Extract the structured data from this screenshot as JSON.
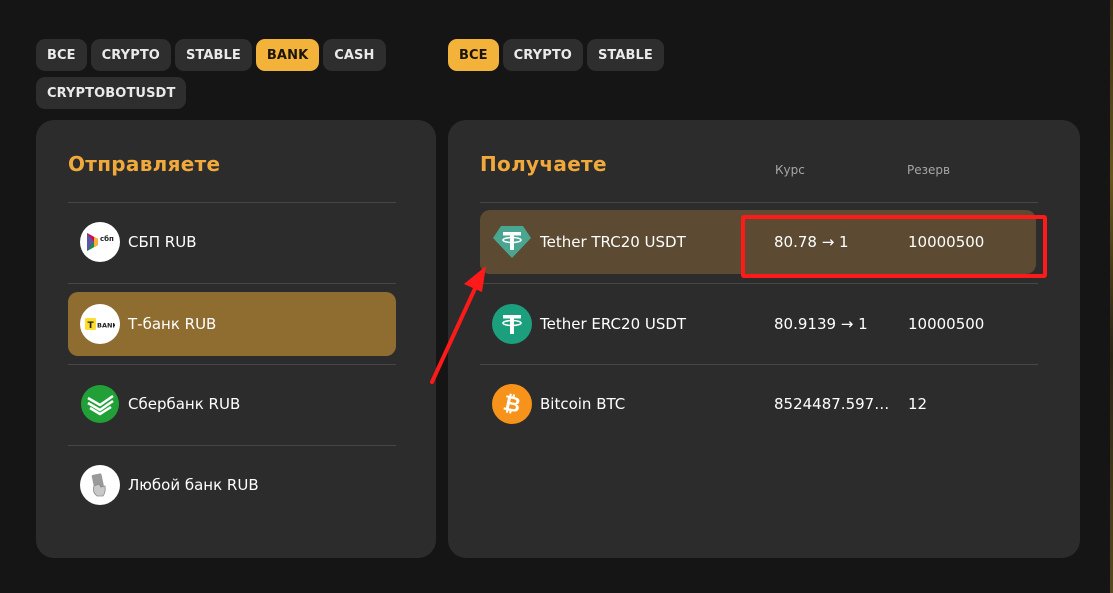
{
  "send_filters": [
    "ВСЕ",
    "CRYPTO",
    "STABLE",
    "BANK",
    "CASH",
    "CRYPTOBOTUSDT"
  ],
  "send_filter_active": "BANK",
  "receive_filters": [
    "ВСЕ",
    "CRYPTO",
    "STABLE"
  ],
  "receive_filter_active": "ВСЕ",
  "send": {
    "title": "Отправляете",
    "items": [
      {
        "label": "СБП RUB",
        "icon": "sbp-logo-icon"
      },
      {
        "label": "Т-банк RUB",
        "icon": "tbank-logo-icon"
      },
      {
        "label": "Сбербанк RUB",
        "icon": "sberbank-logo-icon"
      },
      {
        "label": "Любой банк RUB",
        "icon": "card-in-hand-icon"
      }
    ],
    "selected": "Т-банк RUB"
  },
  "receive": {
    "title": "Получаете",
    "rate_header": "Курс",
    "reserve_header": "Резерв",
    "items": [
      {
        "label": "Tether TRC20 USDT",
        "rate": "80.78 → 1",
        "reserve": "10000500",
        "icon": "tether-trc20-icon"
      },
      {
        "label": "Tether ERC20 USDT",
        "rate": "80.9139 → 1",
        "reserve": "10000500",
        "icon": "tether-erc20-icon"
      },
      {
        "label": "Bitcoin BTC",
        "rate": "8524487.597 …",
        "reserve": "12",
        "icon": "bitcoin-icon"
      }
    ],
    "highlighted": "Tether TRC20 USDT"
  },
  "colors": {
    "accent": "#f3b23a",
    "title": "#f0a93a",
    "selected_row": "#8f6d31",
    "highlight_row": "#5c4a32",
    "annotation": "#ff1a1a",
    "tether_trc": "#4aa591",
    "tether_erc": "#1b9f7d",
    "bitcoin": "#f7931a",
    "sberbank": "#21a038"
  },
  "tbank_logo_text": "BANK",
  "sbp_logo_text": "сбп"
}
